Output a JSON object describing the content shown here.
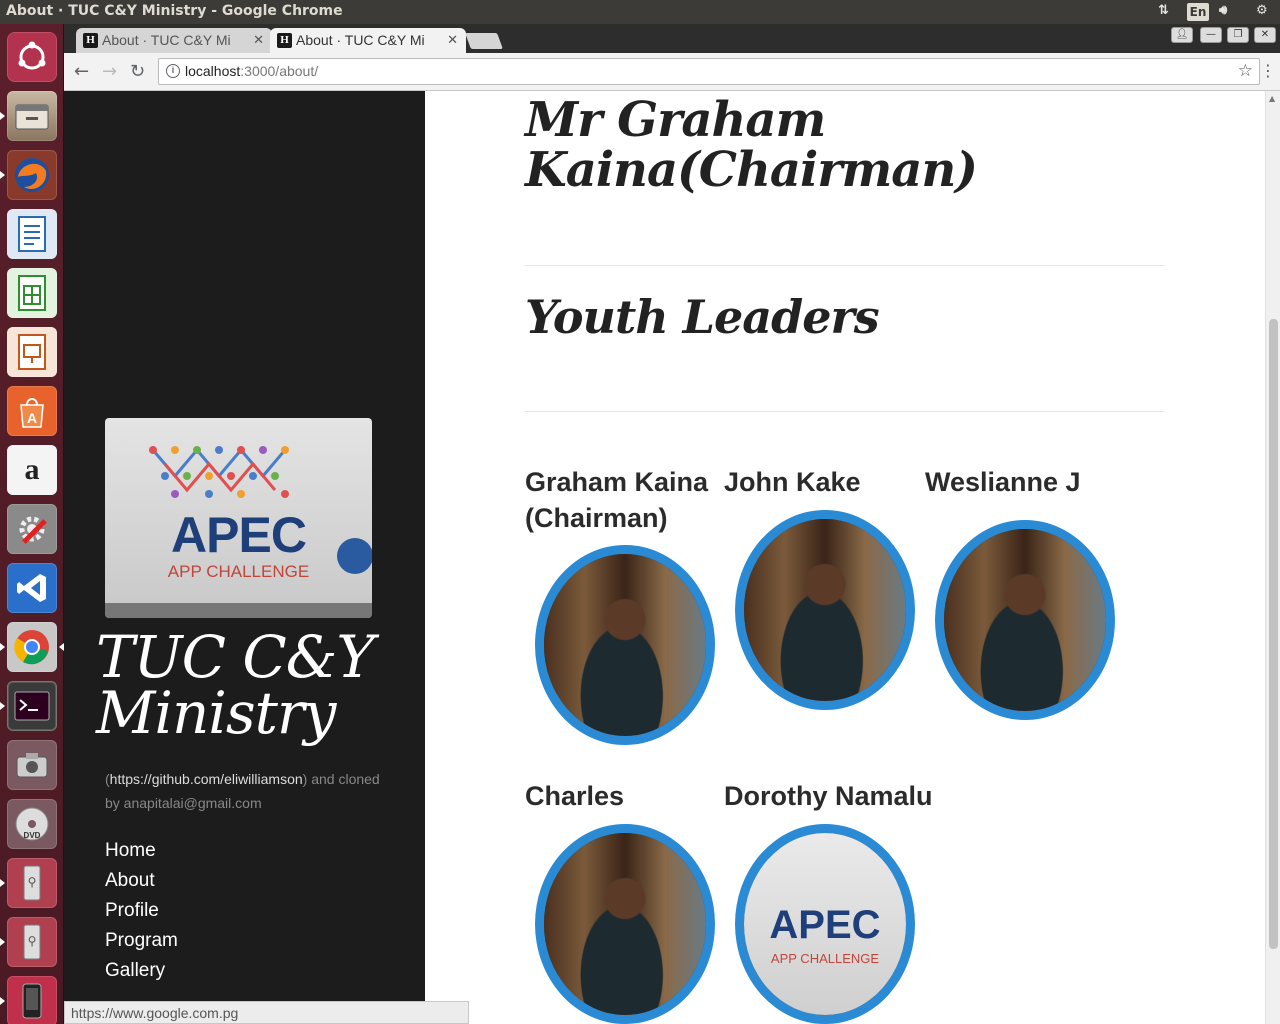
{
  "os": {
    "window_title": "About · TUC C&Y Ministry - Google Chrome",
    "language": "En"
  },
  "launcher": {
    "items": [
      "ubuntu-dash",
      "files",
      "firefox",
      "libreoffice-writer",
      "libreoffice-calc",
      "libreoffice-impress",
      "software-center",
      "amazon",
      "system-settings",
      "vscode",
      "chrome",
      "terminal",
      "camera",
      "dvd",
      "usb-drive-1",
      "usb-drive-2",
      "mobile-device"
    ]
  },
  "browser": {
    "tabs": [
      {
        "label": "About · TUC C&Y Mi",
        "favicon": "H"
      },
      {
        "label": "About · TUC C&Y Mi",
        "favicon": "H"
      }
    ],
    "url_host": "localhost",
    "url_path": ":3000/about/",
    "status_url": "https://www.google.com.pg"
  },
  "sidebar": {
    "banner": {
      "brand": "APEC",
      "sub": "APP CHALLENGE"
    },
    "site_title": "TUC C&Y Ministry",
    "credit_open": "(",
    "credit_link": "https://github.com/eliwilliamson",
    "credit_rest": ") and cloned by anapitalai@gmail.com",
    "nav": [
      "Home",
      "About",
      "Profile",
      "Program",
      "Gallery"
    ]
  },
  "main": {
    "chairman_heading": "Mr Graham Kaina(Chairman)",
    "section_heading": "Youth Leaders",
    "leaders": [
      {
        "name": "Graham Kaina (Chairman)",
        "photo": "person"
      },
      {
        "name": "John Kake",
        "photo": "person"
      },
      {
        "name": "Weslianne J",
        "photo": "person"
      },
      {
        "name": "Charles",
        "photo": "person"
      },
      {
        "name": "Dorothy Namalu",
        "photo": "apec"
      }
    ]
  },
  "colors": {
    "accent": "#2a8ad4",
    "sidebar_bg": "#1c1c1c",
    "launcher_bg": "#5a1f2a"
  }
}
